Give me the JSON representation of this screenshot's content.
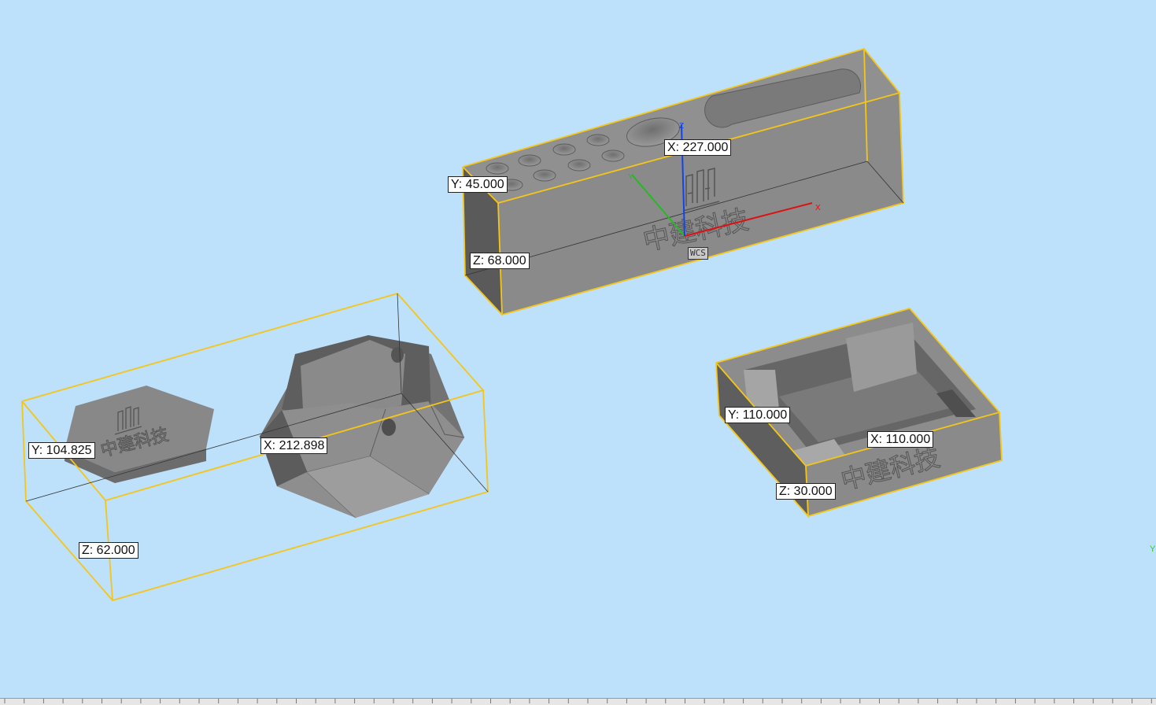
{
  "viewport": {
    "background": "#bde0fb",
    "bbox_color": "#f5c518",
    "model_color": "#8c8c8c"
  },
  "engraving": {
    "text": "中建科技"
  },
  "models": {
    "pen_holder": {
      "dims": {
        "x": "X: 227.000",
        "y": "Y: 45.000",
        "z": "Z: 68.000"
      }
    },
    "ashtray_with_lid": {
      "dims": {
        "x": "X: 212.898",
        "y": "Y: 104.825",
        "z": "Z: 62.000"
      }
    },
    "square_ashtray": {
      "dims": {
        "x": "X: 110.000",
        "y": "Y: 110.000",
        "z": "Z: 30.000"
      }
    }
  },
  "gizmo": {
    "wcs_label": "WCS",
    "x_label": "X",
    "y_label": "Y",
    "z_label": "Z",
    "x_color": "#dd1111",
    "y_color": "#22bb22",
    "z_color": "#1144ee"
  },
  "edge_axis_label": "Y"
}
